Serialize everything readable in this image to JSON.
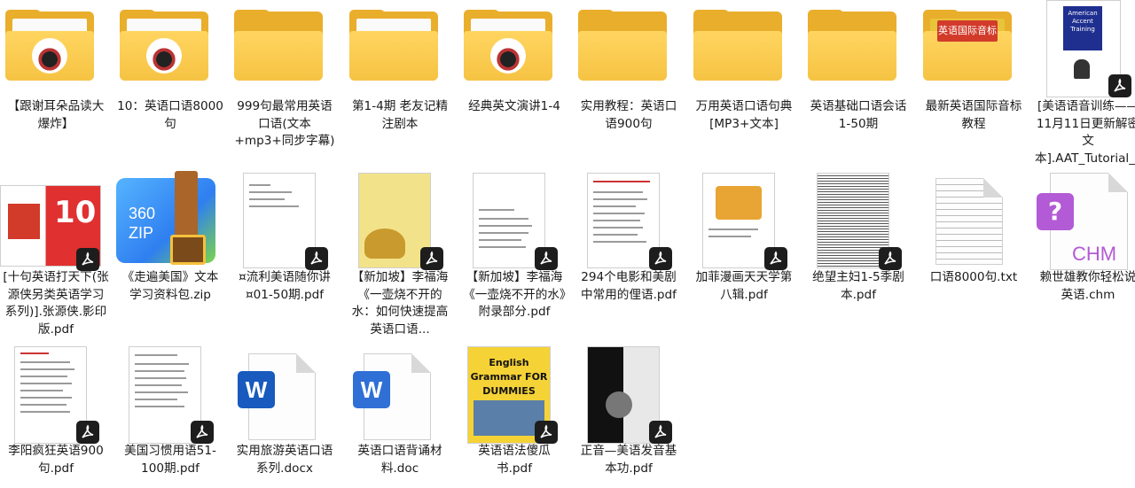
{
  "files": [
    {
      "label": "【跟谢耳朵品读大爆炸】",
      "icon": "folder-icon"
    },
    {
      "label": "10：英语口语8000句",
      "icon": "folder-icon"
    },
    {
      "label": "999句最常用英语口语(文本+mp3+同步字幕)",
      "icon": "folder-icon"
    },
    {
      "label": "第1-4期 老友记精注剧本",
      "icon": "folder-icon"
    },
    {
      "label": "经典英文演讲1-4",
      "icon": "folder-icon"
    },
    {
      "label": "实用教程：英语口语900句",
      "icon": "folder-icon"
    },
    {
      "label": "万用英语口语句典[MP3+文本]",
      "icon": "folder-icon"
    },
    {
      "label": "英语基础口语会话1-50期",
      "icon": "folder-icon"
    },
    {
      "label": "最新英语国际音标教程",
      "icon": "folder-icon",
      "thumb_text": "英语国际音标"
    },
    {
      "label": "[美语语音训练——11月11日更新解密文本].AAT_Tutorial_...",
      "icon": "pdf-icon",
      "thumb_text": "American Accent Training"
    },
    {
      "label": "[十句英语打天下(张源侠另类英语学习系列)].张源侠.影印版.pdf",
      "icon": "pdf-icon"
    },
    {
      "label": "《走遍美国》文本学习资料包.zip",
      "icon": "zip-icon",
      "thumb_text_1": "360",
      "thumb_text_2": "ZIP"
    },
    {
      "label": "¤流利美语随你讲¤01-50期.pdf",
      "icon": "pdf-icon"
    },
    {
      "label": "【新加坡】李福海《一壶烧不开的水：如何快速提高英语口语...",
      "icon": "pdf-icon"
    },
    {
      "label": "【新加坡】李福海《一壶烧不开的水》附录部分.pdf",
      "icon": "pdf-icon"
    },
    {
      "label": "294个电影和美剧中常用的俚语.pdf",
      "icon": "pdf-icon"
    },
    {
      "label": "加菲漫画天天学第八辑.pdf",
      "icon": "pdf-icon"
    },
    {
      "label": "绝望主妇1-5季剧本.pdf",
      "icon": "pdf-icon"
    },
    {
      "label": "口语8000句.txt",
      "icon": "txt-icon"
    },
    {
      "label": "赖世雄教你轻松说英语.chm",
      "icon": "chm-icon",
      "thumb_text": "CHM"
    },
    {
      "label": "李阳疯狂英语900句.pdf",
      "icon": "pdf-icon"
    },
    {
      "label": "美国习惯用语51-100期.pdf",
      "icon": "pdf-icon"
    },
    {
      "label": "实用旅游英语口语系列.docx",
      "icon": "docx-icon",
      "thumb_text": "W"
    },
    {
      "label": "英语口语背诵材料.doc",
      "icon": "doc-icon",
      "thumb_text": "W"
    },
    {
      "label": "英语语法傻瓜书.pdf",
      "icon": "pdf-icon",
      "thumb_text": "English Grammar FOR DUMMIES"
    },
    {
      "label": "正音—美语发音基本功.pdf",
      "icon": "pdf-icon"
    }
  ]
}
